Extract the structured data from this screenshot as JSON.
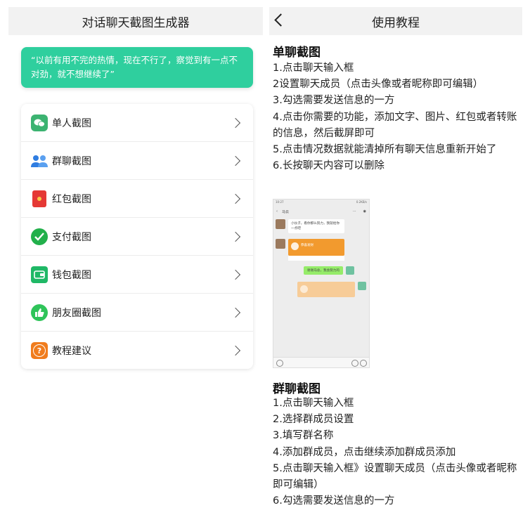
{
  "left_panel": {
    "title": "对话聊天截图生成器",
    "quote": "“以前有用不完的热情，现在不行了，察觉到有一点不对劲，就不想继续了”",
    "menu": [
      {
        "label": "单人截图",
        "icon": "wechat-icon",
        "color": "#3cb371"
      },
      {
        "label": "群聊截图",
        "icon": "group-icon",
        "color": "#2f7de1"
      },
      {
        "label": "红包截图",
        "icon": "red-packet-icon",
        "color": "#e53935"
      },
      {
        "label": "支付截图",
        "icon": "payment-check-icon",
        "color": "#22b04b"
      },
      {
        "label": "钱包截图",
        "icon": "wallet-icon",
        "color": "#1fb866"
      },
      {
        "label": "朋友圈截图",
        "icon": "thumbs-up-icon",
        "color": "#2fc45a"
      },
      {
        "label": "教程建议",
        "icon": "question-icon",
        "color": "#f07c1d"
      }
    ]
  },
  "right_panel": {
    "title": "使用教程",
    "section1": {
      "title": "单聊截图",
      "steps": [
        "1.点击聊天输入框",
        "2设置聊天成员（点击头像或者昵称即可编辑）",
        "3.勾选需要发送信息的一方",
        "4.点击你需要的功能，添加文字、图片、红包或者转账的信息，然后截屏即可",
        "5.点击情况数据就能清掉所有聊天信息重新开始了",
        "6.长按聊天内容可以删除"
      ]
    },
    "section2": {
      "title": "群聊截图",
      "steps": [
        "1.点击聊天输入框",
        "2.选择群成员设置",
        "3.填写群名称",
        "4.添加群成员，点击继续添加群成员添加",
        "5.点击聊天输入框》设置聊天成员（点击头像或者昵称即可编辑）",
        "6.勾选需要发送信息的一方"
      ]
    },
    "preview": {
      "status_left": "10:27",
      "status_right": "0.2KB/s",
      "chat_name": "马云",
      "msg1": "小伙子，看你那么努力，我就给你一点吧",
      "rp_text": "恭喜发财",
      "msg2": "谢谢马总，我会努力的"
    }
  }
}
